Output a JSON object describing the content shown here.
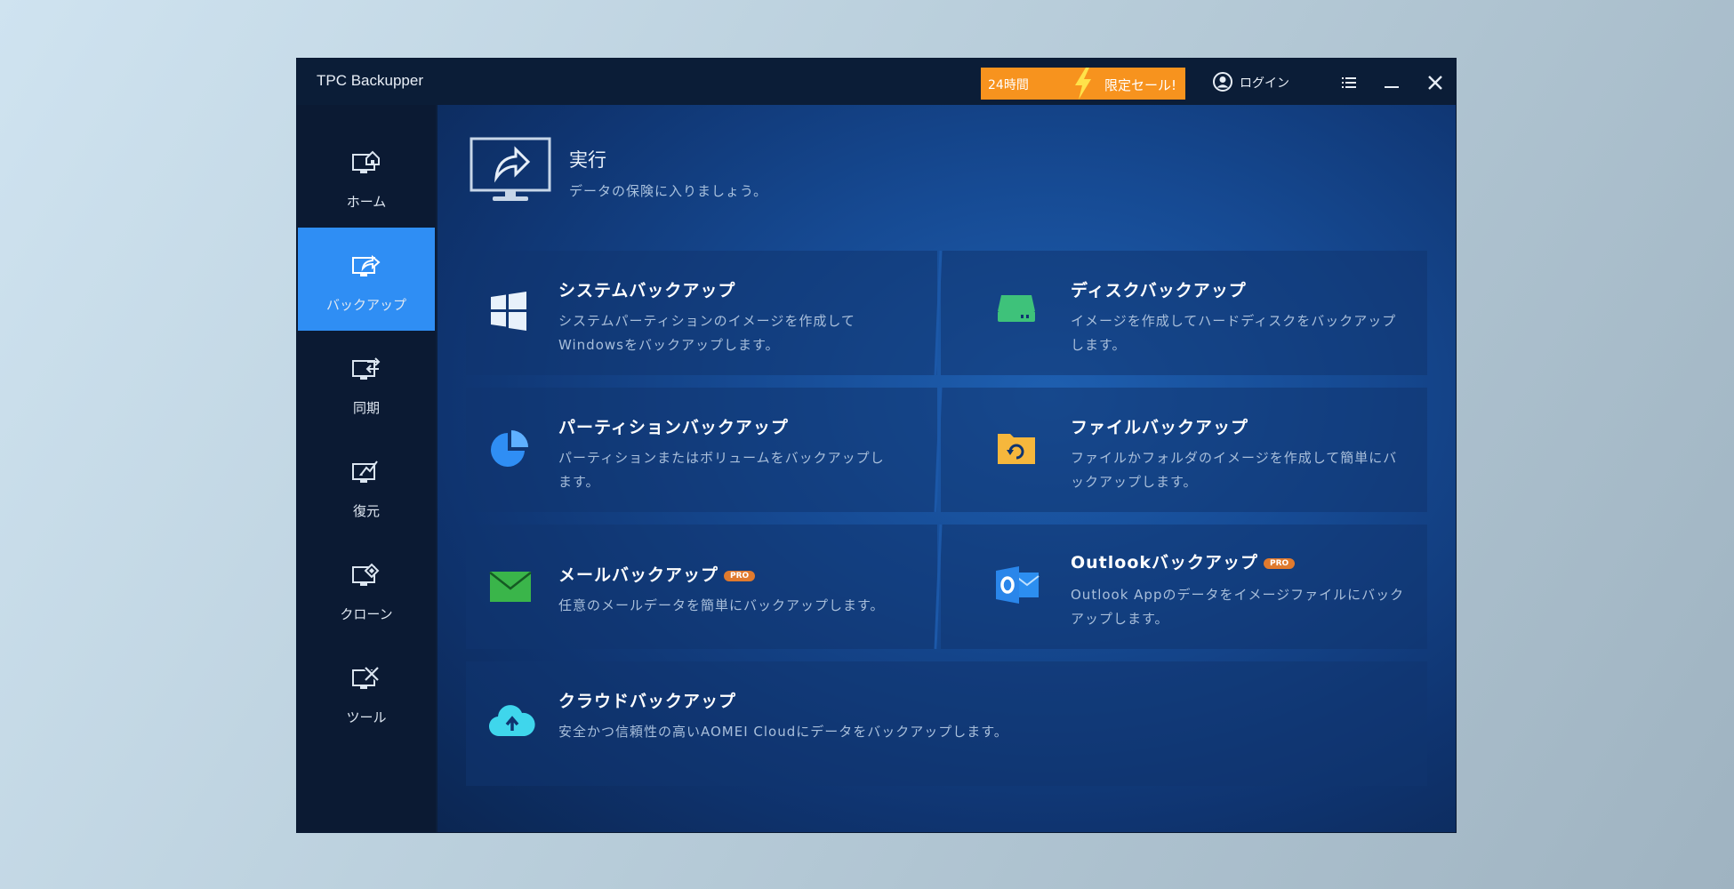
{
  "window": {
    "title": "TPC Backupper",
    "promo": {
      "left": "24時間",
      "right": "限定セール!"
    },
    "login_label": "ログイン"
  },
  "sidebar": {
    "items": [
      {
        "label": "ホーム",
        "icon": "home-monitor-icon",
        "active": false
      },
      {
        "label": "バックアップ",
        "icon": "backup-monitor-icon",
        "active": true
      },
      {
        "label": "同期",
        "icon": "sync-monitor-icon",
        "active": false
      },
      {
        "label": "復元",
        "icon": "restore-monitor-icon",
        "active": false
      },
      {
        "label": "クローン",
        "icon": "clone-monitor-icon",
        "active": false
      },
      {
        "label": "ツール",
        "icon": "tools-monitor-icon",
        "active": false
      }
    ]
  },
  "header": {
    "title": "実行",
    "subtitle": "データの保険に入りましょう。"
  },
  "cards": [
    {
      "title": "システムバックアップ",
      "desc": "システムパーティションのイメージを作成してWindowsをバックアップします。",
      "icon": "windows-icon"
    },
    {
      "title": "ディスクバックアップ",
      "desc": "イメージを作成してハードディスクをバックアップします。",
      "icon": "disk-drive-icon"
    },
    {
      "title": "パーティションバックアップ",
      "desc": "パーティションまたはボリュームをバックアップします。",
      "icon": "partition-pie-icon"
    },
    {
      "title": "ファイルバックアップ",
      "desc": "ファイルかフォルダのイメージを作成して簡単にバックアップします。",
      "icon": "folder-sync-icon"
    },
    {
      "title": "メールバックアップ",
      "badge": "PRO",
      "desc": "任意のメールデータを簡単にバックアップします。",
      "icon": "mail-icon"
    },
    {
      "title": "Outlookバックアップ",
      "badge": "PRO",
      "desc": "Outlook Appのデータをイメージファイルにバックアップします。",
      "icon": "outlook-icon"
    },
    {
      "title": "クラウドバックアップ",
      "desc": "安全かつ信頼性の高いAOMEI Cloudにデータをバックアップします。",
      "icon": "cloud-upload-icon"
    }
  ],
  "colors": {
    "accent": "#2f8ef4",
    "promo": "#f7931e",
    "badge": "#e07a2e"
  }
}
